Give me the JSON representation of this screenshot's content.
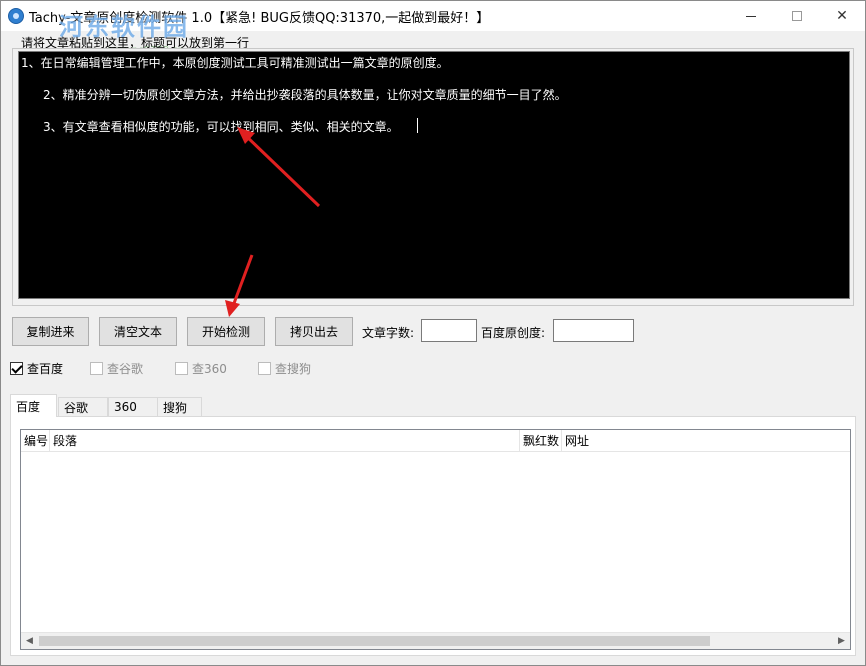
{
  "window": {
    "title": "Tachy-文章原创度检测软件 1.0【紧急! BUG反馈QQ:31370,一起做到最好！】",
    "watermark": "河东软件园",
    "watermark_sub": "www.pc0359.cn",
    "min_icon": "minimize-icon",
    "max_icon": "maximize-icon",
    "close_label": "✕"
  },
  "hint": "请将文章粘贴到这里，标题可以放到第一行",
  "editor": {
    "lines": [
      "1、在日常编辑管理工作中，本原创度测试工具可精准测试出一篇文章的原创度。",
      "2、精准分辨一切伪原创文章方法，并给出抄袭段落的具体数量，让你对文章质量的细节一目了然。",
      "3、有文章查看相似度的功能，可以找到相同、类似、相关的文章。"
    ]
  },
  "toolbar": {
    "copy_in": "复制进来",
    "clear": "清空文本",
    "start": "开始检测",
    "copy_out": "拷贝出去",
    "word_count_label": "文章字数:",
    "word_count_value": "",
    "baidu_orig_label": "百度原创度:",
    "baidu_orig_value": ""
  },
  "checks": [
    {
      "label": "查百度",
      "checked": true,
      "enabled": true
    },
    {
      "label": "查谷歌",
      "checked": false,
      "enabled": false
    },
    {
      "label": "查360",
      "checked": false,
      "enabled": false
    },
    {
      "label": "查搜狗",
      "checked": false,
      "enabled": false
    }
  ],
  "tabs": [
    "百度",
    "谷歌",
    "360",
    "搜狗"
  ],
  "active_tab": "百度",
  "table": {
    "columns": [
      "编号",
      "段落",
      "飘红数",
      "网址"
    ],
    "rows": []
  },
  "colors": {
    "editor_bg": "#000000",
    "editor_text": "#ffffff",
    "annotation_arrow": "#e02020"
  }
}
